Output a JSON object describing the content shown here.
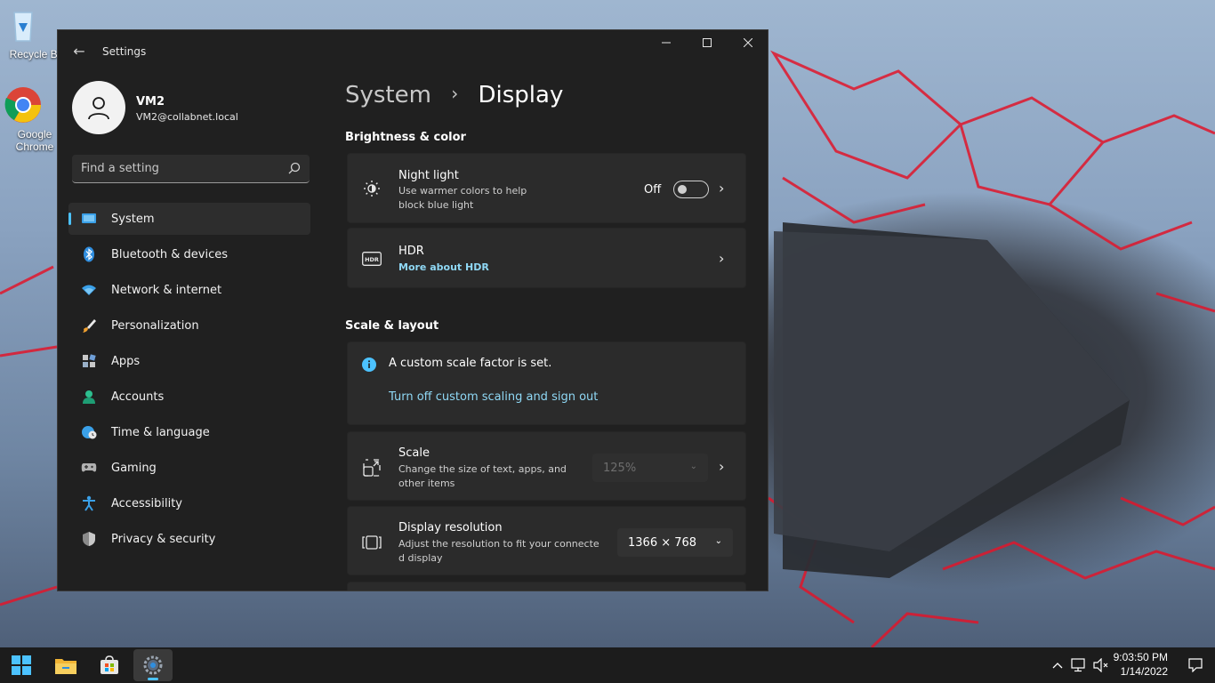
{
  "desktop": {
    "icons": [
      {
        "label": "Recycle Bi",
        "icon": "recycle-bin-icon"
      },
      {
        "label": "Google Chrome",
        "icon": "chrome-icon"
      }
    ]
  },
  "window": {
    "title": "Settings",
    "controls": {
      "minimize": "minimize-icon",
      "maximize": "maximize-icon",
      "close": "close-icon"
    }
  },
  "profile": {
    "name": "VM2",
    "email": "VM2@collabnet.local"
  },
  "search": {
    "placeholder": "Find a setting"
  },
  "nav": {
    "items": [
      {
        "label": "System",
        "icon": "system-icon",
        "selected": true
      },
      {
        "label": "Bluetooth & devices",
        "icon": "bluetooth-icon"
      },
      {
        "label": "Network & internet",
        "icon": "wifi-icon"
      },
      {
        "label": "Personalization",
        "icon": "brush-icon"
      },
      {
        "label": "Apps",
        "icon": "apps-icon"
      },
      {
        "label": "Accounts",
        "icon": "person-icon"
      },
      {
        "label": "Time & language",
        "icon": "globe-clock-icon"
      },
      {
        "label": "Gaming",
        "icon": "gamepad-icon"
      },
      {
        "label": "Accessibility",
        "icon": "accessibility-icon"
      },
      {
        "label": "Privacy & security",
        "icon": "shield-icon"
      }
    ]
  },
  "breadcrumb": {
    "parent": "System",
    "separator": "›",
    "current": "Display"
  },
  "brightness": {
    "section_title": "Brightness & color",
    "night_light": {
      "title": "Night light",
      "desc": "Use warmer colors to help block blue light",
      "state": "Off",
      "enabled": false
    },
    "hdr": {
      "title": "HDR",
      "link": "More about HDR"
    }
  },
  "scale_layout": {
    "section_title": "Scale & layout",
    "info": {
      "text": "A custom scale factor is set.",
      "link": "Turn off custom scaling and sign out"
    },
    "scale": {
      "title": "Scale",
      "desc": "Change the size of text, apps, and other items",
      "value": "125%"
    },
    "resolution": {
      "title": "Display resolution",
      "desc": "Adjust the resolution to fit your connecte d display",
      "value": "1366 × 768"
    }
  },
  "taskbar": {
    "apps": [
      "start-icon",
      "file-explorer-icon",
      "store-icon",
      "settings-icon"
    ],
    "tray": [
      "chevron-up-icon",
      "network-icon",
      "volume-muted-icon",
      "notification-icon"
    ],
    "time": "9:03:50 PM",
    "date": "1/14/2022"
  },
  "colors": {
    "accent": "#4cc2ff",
    "link": "#8fd8f5",
    "window_bg": "#202020",
    "card_bg": "#2b2b2b"
  }
}
